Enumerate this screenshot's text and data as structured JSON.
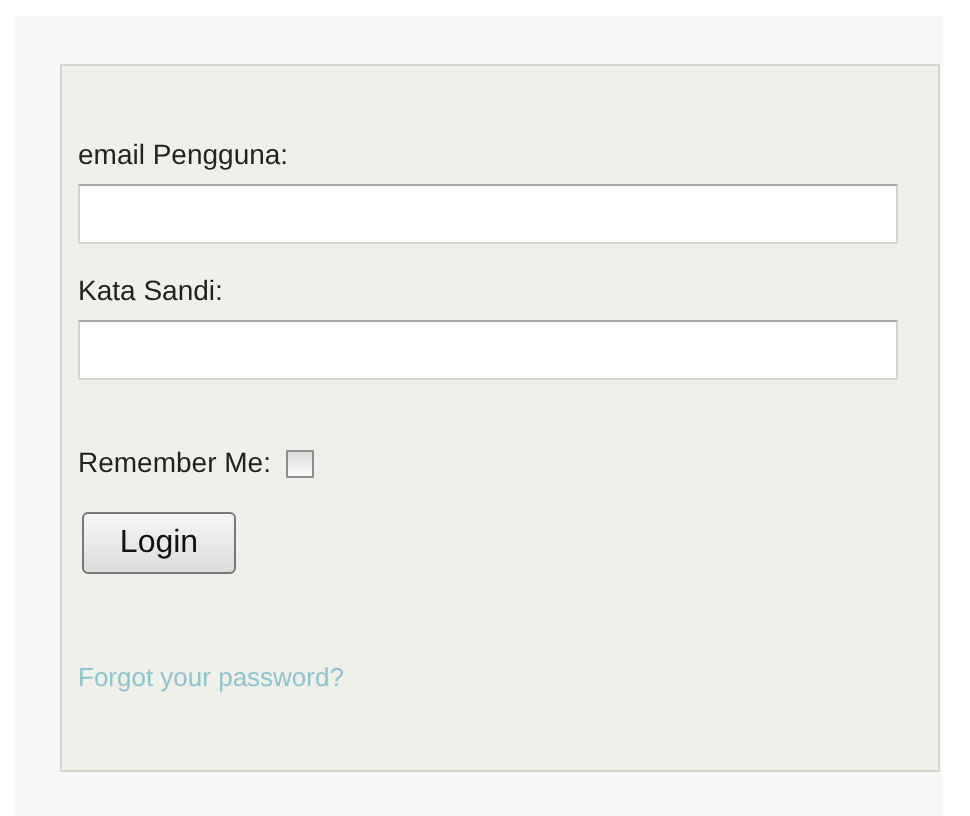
{
  "fields": [
    {
      "label": "email Pengguna:"
    },
    {
      "label": "Kata Sandi:"
    }
  ],
  "remember": {
    "label": "Remember Me:",
    "checked": false
  },
  "login_button": "Login",
  "forgot_link": "Forgot your password?"
}
